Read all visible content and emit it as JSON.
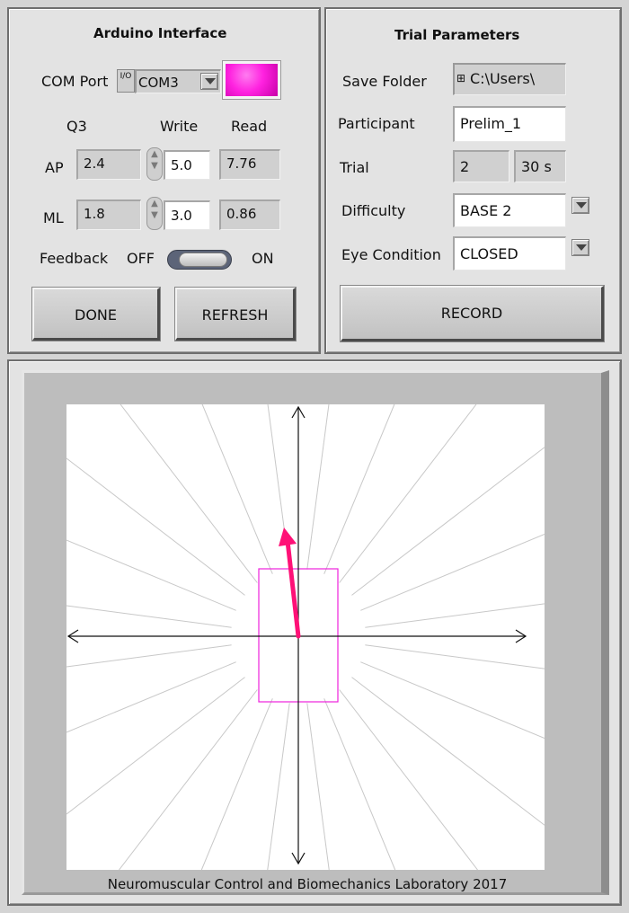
{
  "arduino": {
    "title": "Arduino Interface",
    "com_port_label": "COM Port",
    "com_port_value": "COM3",
    "io_glyph": "I/O",
    "status_color": "#ff22e0",
    "col_q3": "Q3",
    "col_write": "Write",
    "col_read": "Read",
    "ap_label": "AP",
    "ap_q3": "2.4",
    "ap_write": "5.0",
    "ap_read": "7.76",
    "ml_label": "ML",
    "ml_q3": "1.8",
    "ml_write": "3.0",
    "ml_read": "0.86",
    "feedback_label": "Feedback",
    "off_label": "OFF",
    "on_label": "ON",
    "done_label": "DONE",
    "refresh_label": "REFRESH"
  },
  "trial": {
    "title": "Trial Parameters",
    "save_folder_label": "Save Folder",
    "save_folder_value": "C:\\Users\\",
    "participant_label": "Participant",
    "participant_value": "Prelim_1",
    "trial_label": "Trial",
    "trial_number": "2",
    "trial_duration": "30 s",
    "difficulty_label": "Difficulty",
    "difficulty_value": "BASE 2",
    "eye_label": "Eye Condition",
    "eye_value": "CLOSED",
    "record_label": "RECORD"
  },
  "plot": {
    "credit": "Neuromuscular Control and Biomechanics Laboratory 2017",
    "target_color": "#ee22dd",
    "arrow_color": "#ff1177",
    "ray_color": "#c8c8c8",
    "axis_color": "#111111"
  }
}
